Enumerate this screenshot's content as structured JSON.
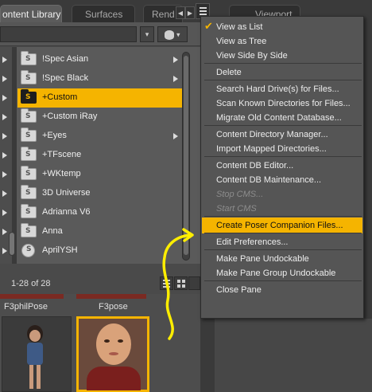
{
  "tabs": {
    "content_library": "ontent Library",
    "surfaces": "Surfaces",
    "render": "Rend",
    "viewport": "Viewport"
  },
  "toolbar": {
    "search_value": "",
    "db_label": "▾"
  },
  "folders": [
    {
      "label": "!Spec Asian",
      "icon": "folder-database-icon",
      "has_sub": true,
      "selected": false
    },
    {
      "label": "!Spec Black",
      "icon": "folder-database-icon",
      "has_sub": true,
      "selected": false
    },
    {
      "label": "+Custom",
      "icon": "folder-database-icon",
      "has_sub": false,
      "selected": true
    },
    {
      "label": "+Custom iRay",
      "icon": "folder-database-icon",
      "has_sub": false,
      "selected": false
    },
    {
      "label": "+Eyes",
      "icon": "folder-database-icon",
      "has_sub": true,
      "selected": false
    },
    {
      "label": "+TFscene",
      "icon": "folder-database-icon",
      "has_sub": false,
      "selected": false
    },
    {
      "label": "+WKtemp",
      "icon": "folder-database-icon",
      "has_sub": false,
      "selected": false
    },
    {
      "label": "3D Universe",
      "icon": "folder-database-icon",
      "has_sub": false,
      "selected": false
    },
    {
      "label": "Adrianna V6",
      "icon": "folder-database-icon",
      "has_sub": false,
      "selected": false
    },
    {
      "label": "Anna",
      "icon": "folder-database-icon",
      "has_sub": false,
      "selected": false
    },
    {
      "label": "AprilYSH",
      "icon": "product-icon",
      "has_sub": false,
      "selected": false
    }
  ],
  "results": {
    "count": "1-28 of 28",
    "thumb_labels": [
      "F3philPose",
      "F3pose"
    ]
  },
  "menu": {
    "items": [
      {
        "label": "View as List",
        "checked": true
      },
      {
        "label": "View as Tree"
      },
      {
        "label": "View Side By Side"
      },
      {
        "sep": true
      },
      {
        "label": "Delete"
      },
      {
        "sep": true
      },
      {
        "label": "Search Hard Drive(s) for Files..."
      },
      {
        "label": "Scan Known Directories for Files..."
      },
      {
        "label": "Migrate Old Content Database..."
      },
      {
        "sep": true
      },
      {
        "label": "Content Directory Manager..."
      },
      {
        "label": "Import Mapped Directories..."
      },
      {
        "sep": true
      },
      {
        "label": "Content DB Editor..."
      },
      {
        "label": "Content DB Maintenance..."
      },
      {
        "label": "Stop CMS...",
        "disabled": true
      },
      {
        "label": "Start CMS",
        "disabled": true
      },
      {
        "sep": true
      },
      {
        "label": "Create Poser Companion Files...",
        "highlight": true
      },
      {
        "sep": true
      },
      {
        "label": "Edit Preferences..."
      },
      {
        "sep": true
      },
      {
        "label": "Make Pane Undockable"
      },
      {
        "label": "Make Pane Group Undockable"
      },
      {
        "sep": true
      },
      {
        "label": "Close Pane"
      }
    ]
  },
  "colors": {
    "accent": "#f5b400",
    "panel": "#5a5a5a",
    "menu": "#555555"
  }
}
